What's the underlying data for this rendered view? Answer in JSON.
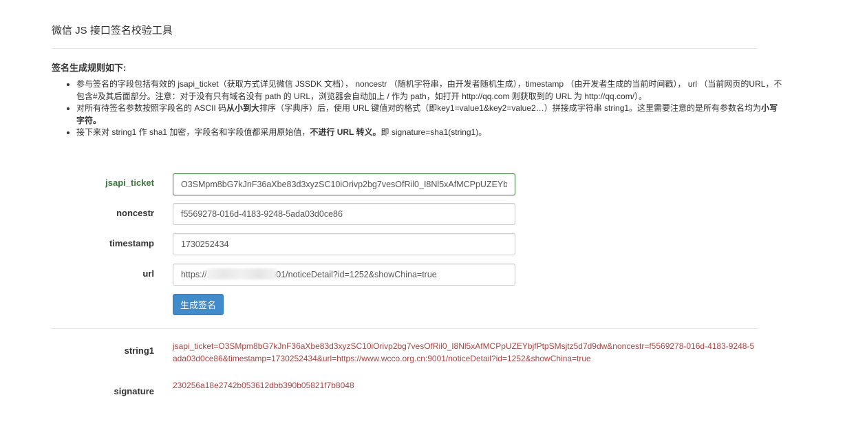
{
  "page": {
    "title": "微信 JS 接口签名校验工具"
  },
  "rules": {
    "heading": "签名生成规则如下:",
    "item1": "参与签名的字段包括有效的 jsapi_ticket（获取方式详见微信 JSSDK 文档）， noncestr （随机字符串，由开发者随机生成），timestamp （由开发者生成的当前时间戳）， url （当前网页的URL，不包含#及其后面部分。注意：对于没有只有域名没有 path 的 URL，浏览器会自动加上 / 作为 path，如打开 http://qq.com 则获取到的 URL 为 http://qq.com/）。",
    "item2_a": "对所有待签名参数按照字段名的 ASCII 码",
    "item2_b": "从小到大",
    "item2_c": "排序（字典序）后，使用 URL 键值对的格式（即key1=value1&key2=value2…）拼接成字符串 string1。这里需要注意的是所有参数名均为",
    "item2_d": "小写字符。",
    "item3_a": "接下来对 string1 作 sha1 加密，字段名和字段值都采用原始值，",
    "item3_b": "不进行 URL 转义。",
    "item3_c": "即 signature=sha1(string1)。"
  },
  "form": {
    "jsapi_ticket": {
      "label": "jsapi_ticket",
      "value": "O3SMpm8bG7kJnF36aXbe83d3xyzSC10iOrivp2bg7vesOfRil0_I8Nl5xAfMCPpUZEYbjfPtpSMsjtz5d7d9dw"
    },
    "noncestr": {
      "label": "noncestr",
      "value": "f5569278-016d-4183-9248-5ada03d0ce86"
    },
    "timestamp": {
      "label": "timestamp",
      "value": "1730252434"
    },
    "url": {
      "label": "url",
      "value": "https://                        :9001/noticeDetail?id=1252&showChina=true"
    },
    "submit_label": "生成签名"
  },
  "result": {
    "string1_label": "string1",
    "string1_value": "jsapi_ticket=O3SMpm8bG7kJnF36aXbe83d3xyzSC10iOrivp2bg7vesOfRil0_I8Nl5xAfMCPpUZEYbjfPtpSMsjtz5d7d9dw&noncestr=f5569278-016d-4183-9248-5ada03d0ce86&timestamp=1730252434&url=https://www.wcco.org.cn:9001/noticeDetail?id=1252&showChina=true",
    "signature_label": "signature",
    "signature_value": "230256a18e2742b053612dbb390b05821f7b8048"
  },
  "colors": {
    "success": "#3c763d",
    "error_text": "#a94442",
    "primary_button": "#428bca"
  }
}
